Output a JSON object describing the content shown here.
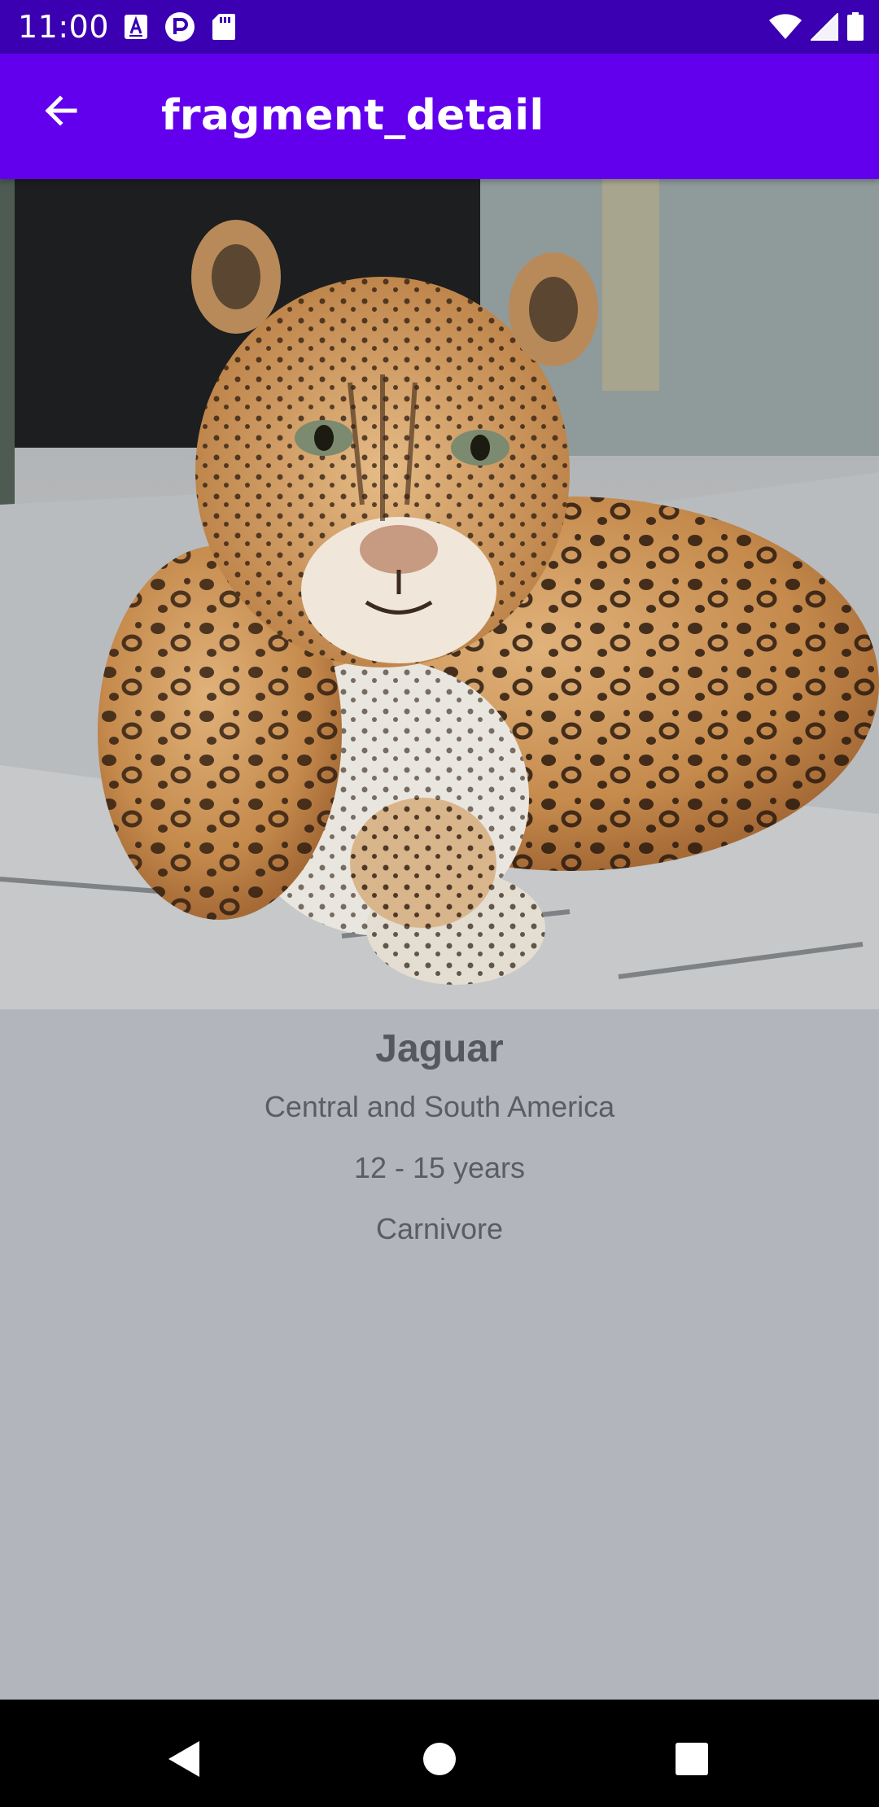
{
  "status_bar": {
    "time": "11:00",
    "left_icons": [
      "text-format-icon",
      "p-badge-icon",
      "sd-card-icon"
    ],
    "right_icons": [
      "wifi-icon",
      "cell-signal-icon",
      "battery-icon"
    ]
  },
  "app_bar": {
    "title": "fragment_detail",
    "back_icon": "arrow-back-icon"
  },
  "image": {
    "subject": "jaguar-photo"
  },
  "details": {
    "name": "Jaguar",
    "region": "Central and South America",
    "lifespan": "12 - 15 years",
    "diet": "Carnivore"
  },
  "nav_bar": {
    "icons": [
      "nav-back-icon",
      "nav-home-icon",
      "nav-recents-icon"
    ]
  },
  "colors": {
    "status_bar": "#3a00b2",
    "app_bar": "#6200ee",
    "content_bg": "#b2b6bc",
    "text": "#5a5d62",
    "nav_bar": "#000000"
  }
}
